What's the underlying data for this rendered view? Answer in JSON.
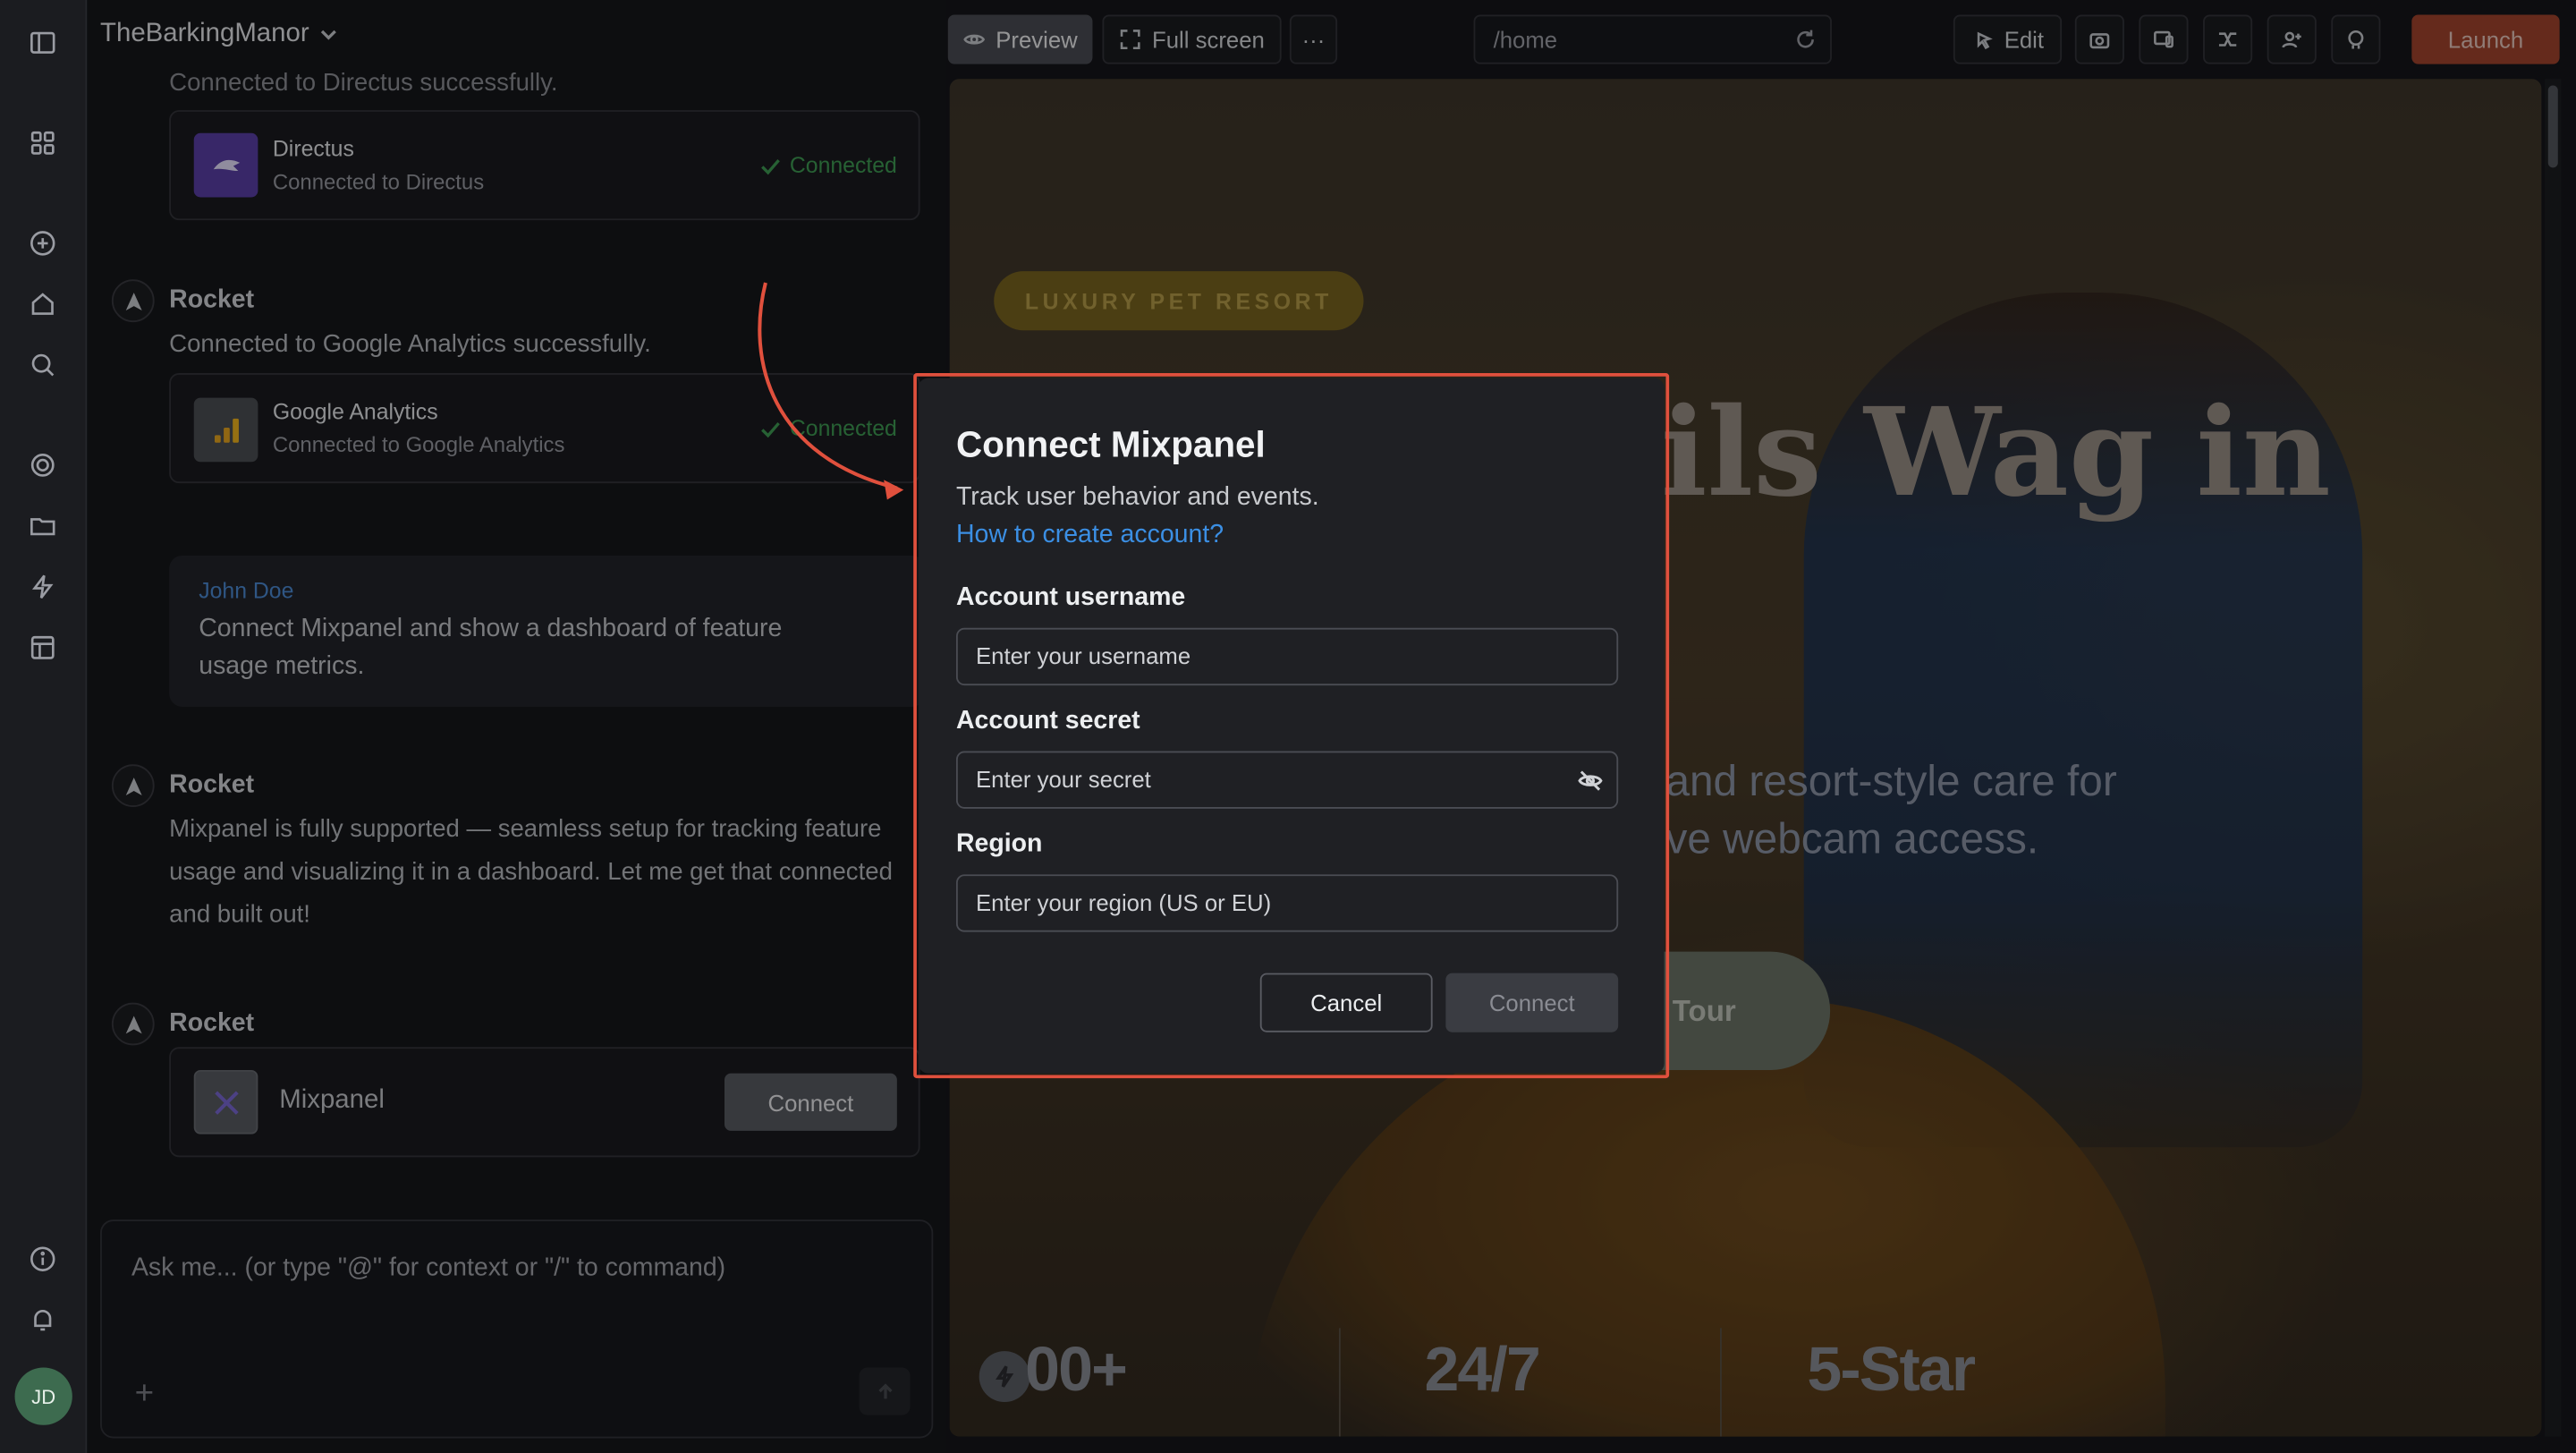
{
  "app": {
    "project_name": "TheBarkingManor"
  },
  "toolbar": {
    "preview_label": "Preview",
    "fullscreen_label": "Full screen",
    "more_label": "···",
    "url": "/home",
    "edit_label": "Edit",
    "launch_label": "Launch"
  },
  "chat": {
    "truncated_line": "Connected to Directus successfully.",
    "directus": {
      "name": "Directus",
      "status": "Connected to Directus",
      "badge": "Connected"
    },
    "ga_agent": "Rocket",
    "ga_text": "Connected to Google Analytics successfully.",
    "ga": {
      "name": "Google Analytics",
      "status": "Connected to Google Analytics",
      "badge": "Connected"
    },
    "user": {
      "name": "John Doe",
      "message": "Connect Mixpanel and show a dashboard of feature usage metrics."
    },
    "reply_agent": "Rocket",
    "reply_text": "Mixpanel is fully supported — seamless setup for tracking feature usage and visualizing it in a dashboard. Let me get that connected and built out!",
    "mix_agent": "Rocket",
    "mixpanel": {
      "name": "Mixpanel",
      "button": "Connect"
    },
    "composer_placeholder": "Ask me... (or type \"@\" for context or \"/\" to command)",
    "composer_plus": "+"
  },
  "preview": {
    "badge": "LUXURY PET RESORT",
    "hero_title": "ils Wag in",
    "hero_sub_1": "and resort-style care for",
    "hero_sub_2": "ve webcam access.",
    "cta": "l Tour",
    "stats": [
      "00+",
      "24/7",
      "5-Star"
    ]
  },
  "modal": {
    "title": "Connect Mixpanel",
    "description": "Track user behavior and events.",
    "help_link": "How to create account?",
    "username_label": "Account username",
    "username_placeholder": "Enter your username",
    "secret_label": "Account secret",
    "secret_placeholder": "Enter your secret",
    "region_label": "Region",
    "region_placeholder": "Enter your region (US or EU)",
    "cancel_label": "Cancel",
    "connect_label": "Connect"
  },
  "user_avatar": "JD",
  "colors": {
    "accent": "#a3452e",
    "highlight": "#e0503d",
    "link": "#3b8fe4",
    "success": "#3f9d54"
  }
}
